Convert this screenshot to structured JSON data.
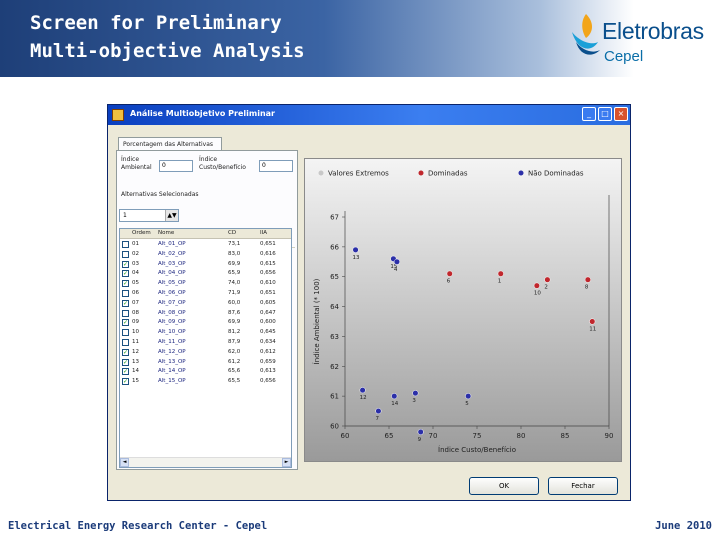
{
  "slide": {
    "title_line1": "Screen for Preliminary",
    "title_line2": "Multi-objective Analysis",
    "logo_name": "Eletrobras",
    "logo_sub": "Cepel",
    "footer_left": "Electrical Energy Research Center - Cepel",
    "footer_right": "June 2010"
  },
  "window": {
    "title": "Análise Multiobjetivo Preliminar",
    "minimize": "_",
    "maximize": "□",
    "close": "×",
    "tab_label": "Porcentagem das Alternativas",
    "indice_ambiental_label1": "Índice",
    "indice_ambiental_label2": "Ambiental",
    "indice_ambiental_value": "0",
    "indice_custo_label1": "Índice",
    "indice_custo_label2": "Custo/Benefício",
    "indice_custo_value": "0",
    "alternativas_label": "Alternativas Selecionadas",
    "stepper_value": "1",
    "stepper_arrows": "▲▼",
    "columns": [
      "Ordem",
      "Nome",
      "CD",
      "IIA"
    ],
    "rows": [
      {
        "checked": false,
        "ordem": "01",
        "nome": "Alt_01_OP",
        "cd": "73,1",
        "ia": "0,651"
      },
      {
        "checked": false,
        "ordem": "02",
        "nome": "Alt_02_OP",
        "cd": "83,0",
        "ia": "0,616"
      },
      {
        "checked": true,
        "ordem": "03",
        "nome": "Alt_03_OP",
        "cd": "69,9",
        "ia": "0,615"
      },
      {
        "checked": true,
        "ordem": "04",
        "nome": "Alt_04_OP",
        "cd": "65,9",
        "ia": "0,656"
      },
      {
        "checked": true,
        "ordem": "05",
        "nome": "Alt_05_OP",
        "cd": "74,0",
        "ia": "0,610"
      },
      {
        "checked": false,
        "ordem": "06",
        "nome": "Alt_06_OP",
        "cd": "71,9",
        "ia": "0,651"
      },
      {
        "checked": true,
        "ordem": "07",
        "nome": "Alt_07_OP",
        "cd": "60,0",
        "ia": "0,605"
      },
      {
        "checked": false,
        "ordem": "08",
        "nome": "Alt_08_OP",
        "cd": "87,6",
        "ia": "0,647"
      },
      {
        "checked": true,
        "ordem": "09",
        "nome": "Alt_09_OP",
        "cd": "69,9",
        "ia": "0,600"
      },
      {
        "checked": false,
        "ordem": "10",
        "nome": "Alt_10_OP",
        "cd": "81,2",
        "ia": "0,645"
      },
      {
        "checked": false,
        "ordem": "11",
        "nome": "Alt_11_OP",
        "cd": "87,9",
        "ia": "0,634"
      },
      {
        "checked": true,
        "ordem": "12",
        "nome": "Alt_12_OP",
        "cd": "62,0",
        "ia": "0,612"
      },
      {
        "checked": true,
        "ordem": "13",
        "nome": "Alt_13_OP",
        "cd": "61,2",
        "ia": "0,659"
      },
      {
        "checked": true,
        "ordem": "14",
        "nome": "Alt_14_OP",
        "cd": "65,6",
        "ia": "0,613"
      },
      {
        "checked": true,
        "ordem": "15",
        "nome": "Alt_15_OP",
        "cd": "65,5",
        "ia": "0,656"
      }
    ],
    "scroll_left": "◄",
    "scroll_right": "►",
    "ok_label": "OK",
    "cancel_label": "Fechar"
  },
  "colors": {
    "extremos": "#c8c8c8",
    "dominadas": "#c0272d",
    "nao_dominadas": "#2b2fa8",
    "chart_bg_top": "#f4f4f4",
    "chart_bg_bottom": "#9a9a9a"
  },
  "chart_data": {
    "type": "scatter",
    "title": "",
    "xlabel": "Índice Custo/Benefício",
    "ylabel": "Índice Ambiental (* 100)",
    "xlim": [
      60,
      90
    ],
    "ylim": [
      60,
      67
    ],
    "x_ticks": [
      "60",
      "65",
      "70",
      "75",
      "80",
      "85",
      "90"
    ],
    "y_ticks": [
      "60",
      "61",
      "62",
      "63",
      "64",
      "65",
      "66",
      "67"
    ],
    "legend_position": "top",
    "series": [
      {
        "name": "Valores Extremos",
        "color_key": "extremos",
        "points": []
      },
      {
        "name": "Dominadas",
        "color_key": "dominadas",
        "points": [
          {
            "label": "6",
            "x": 71.9,
            "y": 65.1
          },
          {
            "label": "1",
            "x": 77.7,
            "y": 65.1
          },
          {
            "label": "10",
            "x": 81.8,
            "y": 64.7
          },
          {
            "label": "2",
            "x": 83.0,
            "y": 64.9
          },
          {
            "label": "8",
            "x": 87.6,
            "y": 64.9
          },
          {
            "label": "11",
            "x": 88.1,
            "y": 63.5
          }
        ]
      },
      {
        "name": "Não Dominadas",
        "color_key": "nao_dominadas",
        "points": [
          {
            "label": "13",
            "x": 61.2,
            "y": 65.9
          },
          {
            "label": "15",
            "x": 65.5,
            "y": 65.6
          },
          {
            "label": "4",
            "x": 65.9,
            "y": 65.5
          },
          {
            "label": "12",
            "x": 62.0,
            "y": 61.2
          },
          {
            "label": "14",
            "x": 65.6,
            "y": 61.0
          },
          {
            "label": "3",
            "x": 68.0,
            "y": 61.1
          },
          {
            "label": "7",
            "x": 63.8,
            "y": 60.5
          },
          {
            "label": "9",
            "x": 68.6,
            "y": 59.8
          },
          {
            "label": "5",
            "x": 74.0,
            "y": 61.0
          }
        ]
      }
    ]
  }
}
